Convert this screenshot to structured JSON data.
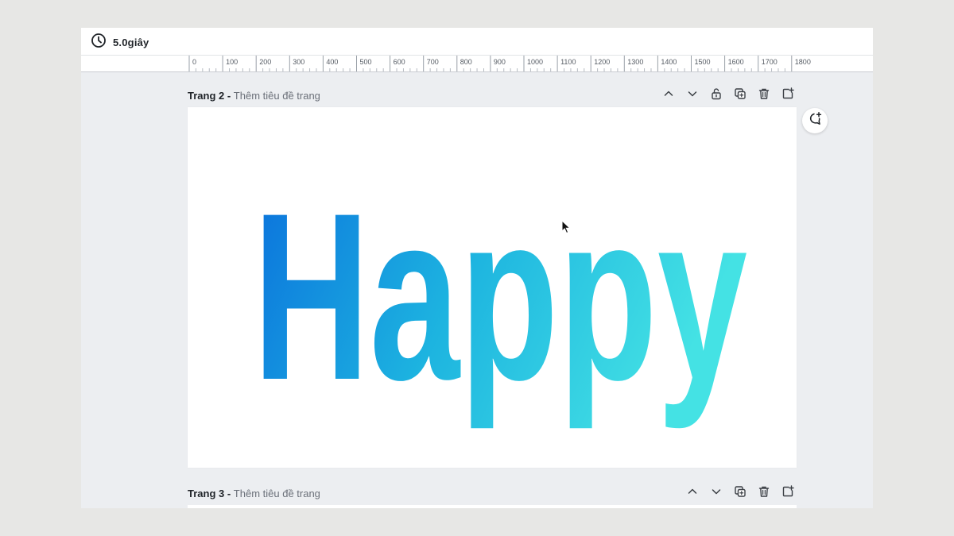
{
  "topbar": {
    "timer_label": "5.0giây",
    "timer_icon": "clock-icon"
  },
  "ruler": {
    "ticks": [
      "0",
      "100",
      "200",
      "300",
      "400",
      "500",
      "600",
      "700",
      "800",
      "900",
      "1000",
      "1100",
      "1200",
      "1300",
      "1400",
      "1500",
      "1600",
      "1700",
      "1800"
    ]
  },
  "pages": [
    {
      "number_label": "Trang 2 - ",
      "subtitle": "Thêm tiêu đề trang",
      "actions": [
        "chevron-up-icon",
        "chevron-down-icon",
        "unlock-icon",
        "duplicate-icon",
        "trash-icon",
        "add-page-icon"
      ],
      "content_text": "Happy",
      "gradient": {
        "start": "#0a6fdc",
        "mid": "#1db4e0",
        "end": "#44e2e4"
      }
    },
    {
      "number_label": "Trang 3 - ",
      "subtitle": "Thêm tiêu đề trang",
      "actions": [
        "chevron-up-icon",
        "chevron-down-icon",
        "duplicate-icon",
        "trash-icon",
        "add-page-icon"
      ]
    }
  ],
  "comment_icon": "add-comment-icon",
  "colors": {
    "background": "#eceef1",
    "icon": "#3b3f45"
  }
}
